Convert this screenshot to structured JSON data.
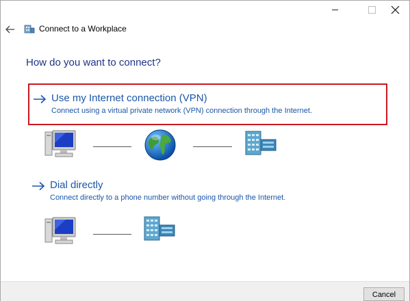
{
  "window": {
    "minimize_icon": "minimize-icon",
    "maximize_icon": "maximize-icon",
    "close_icon": "close-icon"
  },
  "header": {
    "title": "Connect to a Workplace",
    "back_icon": "back-arrow-icon",
    "wizard_icon": "workplace-icon"
  },
  "question": "How do you want to connect?",
  "options": [
    {
      "title": "Use my Internet connection (VPN)",
      "description": "Connect using a virtual private network (VPN) connection through the Internet.",
      "selected": true,
      "diagram": [
        "computer-icon",
        "globe-icon",
        "server-icon"
      ]
    },
    {
      "title": "Dial directly",
      "description": "Connect directly to a phone number without going through the Internet.",
      "selected": false,
      "diagram": [
        "computer-icon",
        "server-icon"
      ]
    }
  ],
  "footer": {
    "cancel_label": "Cancel"
  },
  "colors": {
    "link": "#1a56a8",
    "question": "#1e3287",
    "highlight_border": "#c8171e",
    "footer_bg": "#f0f0f0"
  }
}
